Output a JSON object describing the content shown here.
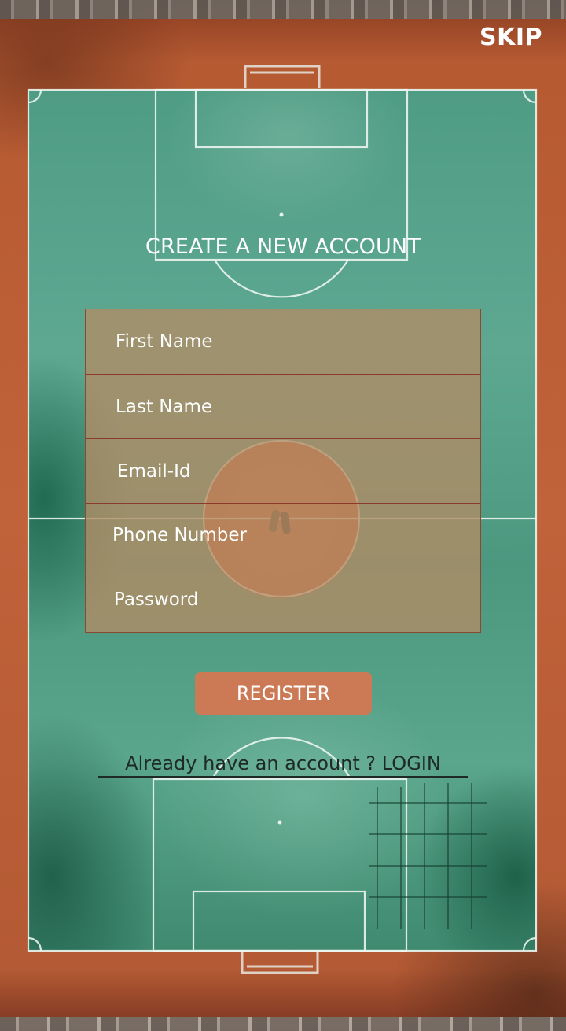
{
  "header": {
    "skip_label": "SKIP"
  },
  "title": "CREATE A NEW ACCOUNT",
  "form": {
    "fields": [
      {
        "placeholder": "First Name",
        "value": ""
      },
      {
        "placeholder": "Last Name",
        "value": ""
      },
      {
        "placeholder": "Email-Id",
        "value": ""
      },
      {
        "placeholder": "Phone Number",
        "value": ""
      },
      {
        "placeholder": "Password",
        "value": ""
      }
    ],
    "register_label": "REGISTER"
  },
  "login_prompt": "Already have an account ? LOGIN",
  "colors": {
    "button": "#cc7a56",
    "form_background": "#b28c64",
    "field_divider": "#8b3a2c",
    "text_light": "#ffffff",
    "text_dark": "#1f2a26"
  }
}
